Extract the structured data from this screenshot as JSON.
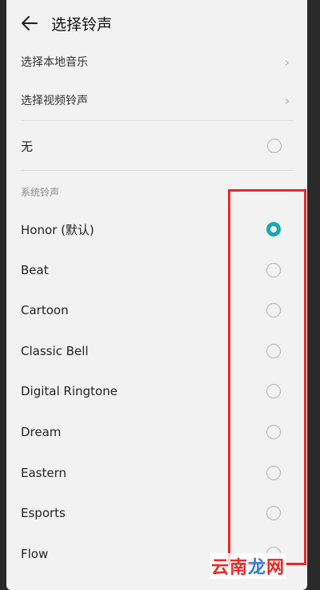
{
  "header": {
    "title": "选择铃声"
  },
  "top_items": [
    {
      "label": "选择本地音乐"
    },
    {
      "label": "选择视频铃声"
    }
  ],
  "none_item": {
    "label": "无"
  },
  "section": {
    "title": "系统铃声"
  },
  "ringtones": [
    {
      "label": "Honor (默认)",
      "selected": true
    },
    {
      "label": "Beat",
      "selected": false
    },
    {
      "label": "Cartoon",
      "selected": false
    },
    {
      "label": "Classic Bell",
      "selected": false
    },
    {
      "label": "Digital Ringtone",
      "selected": false
    },
    {
      "label": "Dream",
      "selected": false
    },
    {
      "label": "Eastern",
      "selected": false
    },
    {
      "label": "Esports",
      "selected": false
    },
    {
      "label": "Flow",
      "selected": false
    }
  ],
  "watermark": {
    "part1": "云南",
    "part2": "龙",
    "part3": "网"
  },
  "colors": {
    "accent": "#1aa7ad",
    "highlight": "#e52a2a"
  }
}
